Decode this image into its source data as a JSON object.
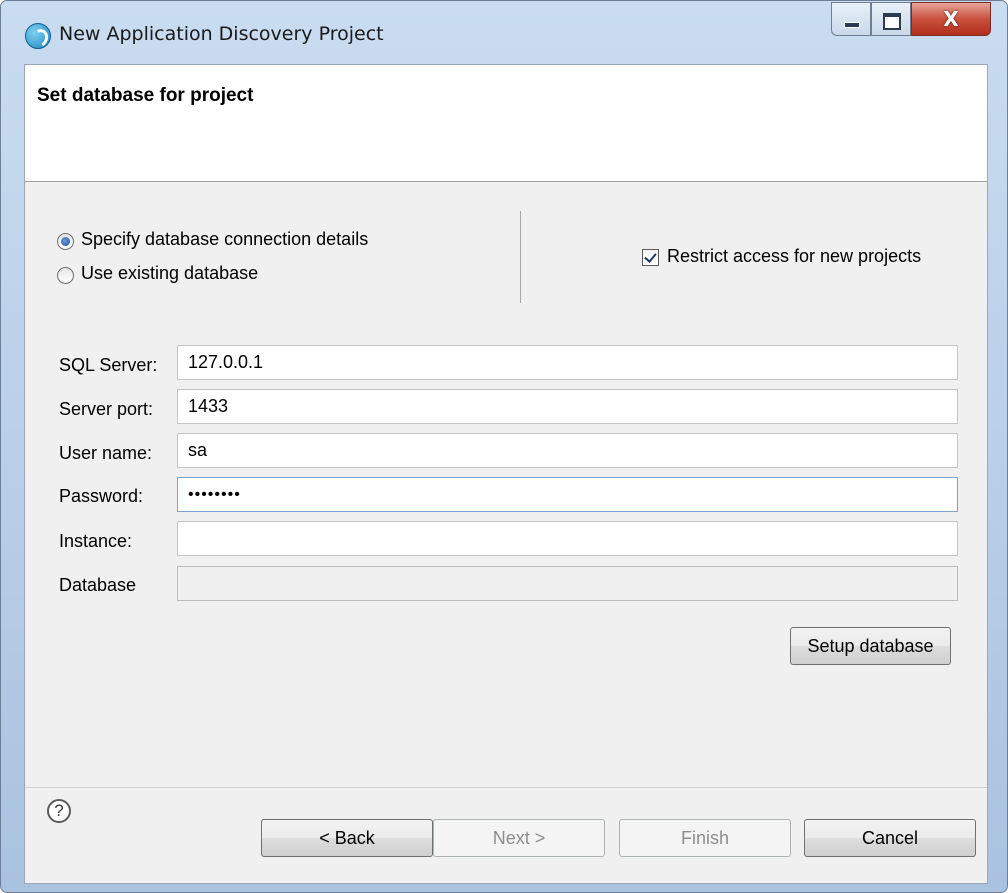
{
  "window": {
    "title": "New Application Discovery Project",
    "close_glyph": "X"
  },
  "banner": {
    "title": "Set database for project"
  },
  "options": {
    "radio_specify": "Specify database connection details",
    "radio_existing": "Use existing database",
    "selected": "specify",
    "restrict_label": "Restrict access for new projects",
    "restrict_checked": true
  },
  "form": {
    "sql_server_label": "SQL Server:",
    "sql_server_value": "127.0.0.1",
    "port_label": "Server port:",
    "port_value": "1433",
    "user_label": "User name:",
    "user_value": "sa",
    "password_label": "Password:",
    "password_value": "••••••••",
    "instance_label": "Instance:",
    "instance_value": "",
    "database_label": "Database",
    "database_value": ""
  },
  "buttons": {
    "setup": "Setup database",
    "back": "< Back",
    "next": "Next >",
    "finish": "Finish",
    "cancel": "Cancel",
    "help_glyph": "?"
  }
}
